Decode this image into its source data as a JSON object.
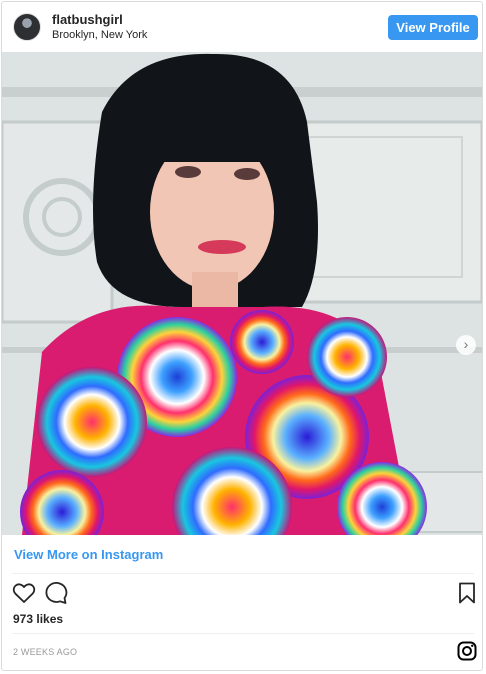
{
  "post": {
    "username": "flatbushgirl",
    "location": "Brooklyn, New York",
    "view_profile_label": "View Profile",
    "view_more_label": "View More on Instagram",
    "likes": "973 likes",
    "timestamp": "2 WEEKS AGO",
    "carousel_next_glyph": "›"
  },
  "icons": {
    "like": "heart-icon",
    "comment": "comment-icon",
    "save": "bookmark-icon",
    "brand": "instagram-icon"
  },
  "colors": {
    "accent": "#3897f0",
    "text": "#262626",
    "muted": "#999999",
    "border": "#dbdbdb"
  }
}
